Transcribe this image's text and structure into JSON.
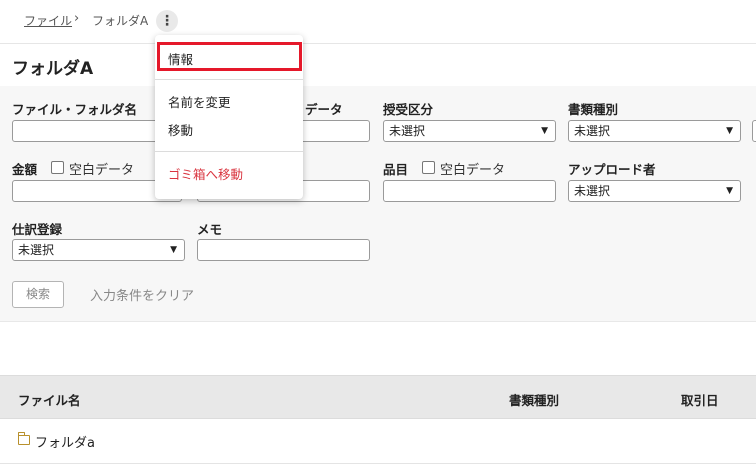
{
  "breadcrumb": {
    "root": "ファイル",
    "separator": "›",
    "current": "フォルダA"
  },
  "kebab_glyph": "⋮",
  "page_title": "フォルダA",
  "filters": {
    "file_folder_name": {
      "label": "ファイル・フォルダ名"
    },
    "partial_data_label": "データ",
    "receive_type": {
      "label": "授受区分",
      "value": "未選択"
    },
    "doc_type": {
      "label": "書類種別",
      "value": "未選択"
    },
    "amount": {
      "label": "金額",
      "blank_label": "空白データ"
    },
    "item": {
      "label": "品目",
      "blank_label": "空白データ"
    },
    "uploader": {
      "label": "アップロード者",
      "value": "未選択"
    },
    "journal": {
      "label": "仕訳登録",
      "value": "未選択"
    },
    "memo": {
      "label": "メモ"
    }
  },
  "actions": {
    "search_label": "検索",
    "clear_label": "入力条件をクリア"
  },
  "table": {
    "columns": [
      "ファイル名",
      "書類種別",
      "取引日"
    ],
    "rows": [
      {
        "name": "フォルダa",
        "icon": "folder-icon"
      }
    ]
  },
  "context_menu": {
    "info": "情報",
    "rename": "名前を変更",
    "move": "移動",
    "trash": "ゴミ箱へ移動"
  },
  "colors": {
    "highlight_border": "#e5182a",
    "danger_text": "#d9343f",
    "folder_icon": "#b8902c"
  }
}
